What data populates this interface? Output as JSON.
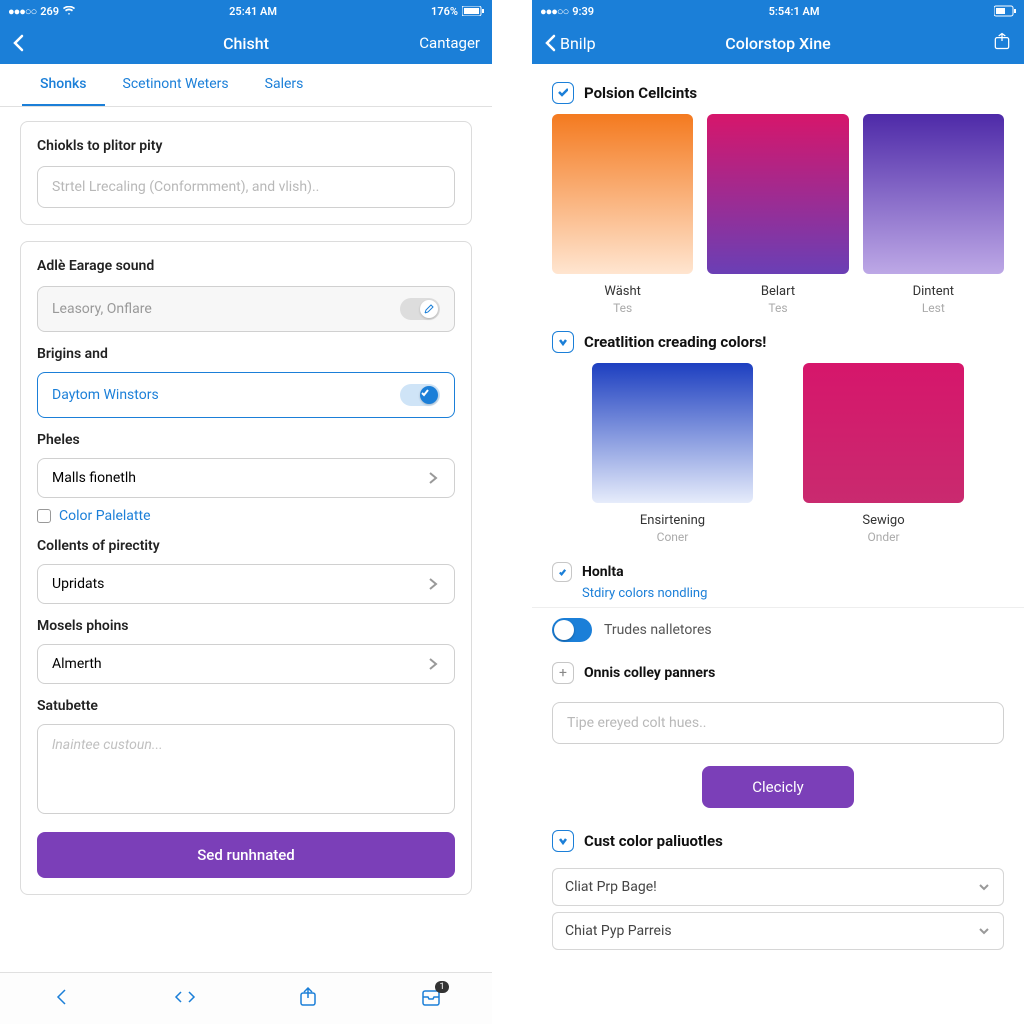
{
  "left": {
    "status": {
      "carrier": "●●●○○",
      "signal": "269",
      "time": "25:41 AM",
      "battery": "176%"
    },
    "nav": {
      "title": "Chisht",
      "right": "Cantager"
    },
    "tabs": [
      "Shonks",
      "Scetinont Weters",
      "Salers"
    ],
    "card1": {
      "title": "Chiokls to plitor pity",
      "placeholder": "Strtel Lrecaling (Conformment), and vlish).."
    },
    "card2": {
      "group_label": "Adlè Earage sound",
      "row1": "Leasory, Onflare",
      "sublabel1": "Brigins and",
      "row2": "Daytom Winstors",
      "sublabel2": "Pheles",
      "row3": "Malls fionetlh",
      "cb_label": "Color Palelatte",
      "sublabel3": "Collents of pirectity",
      "row4": "Upridats",
      "sublabel4": "Mosels phoins",
      "row5": "Almerth",
      "sublabel5": "Satubette",
      "textarea_placeholder": "lnaintee custoun...",
      "submit": "Sed runhnated"
    },
    "tabbar_badge": "1"
  },
  "right": {
    "status": {
      "carrier": "●●●○○",
      "signal": "9:39",
      "time": "5:54:1 AM"
    },
    "nav": {
      "back": "Bnilp",
      "title": "Colorstop Xine"
    },
    "sec1": {
      "title": "Polsion Cellcints",
      "swatches": [
        {
          "name": "Wäsht",
          "sub": "Tes",
          "from": "#f47a1f",
          "to": "#ffe5d0"
        },
        {
          "name": "Belart",
          "sub": "Tes",
          "from": "#d6166b",
          "to": "#6a3fb5"
        },
        {
          "name": "Dintent",
          "sub": "Lest",
          "from": "#4e2aa8",
          "to": "#bda8e6"
        }
      ]
    },
    "sec2": {
      "title": "Creatlition creading colors!",
      "swatches": [
        {
          "name": "Ensirtening",
          "sub": "Coner",
          "from": "#1d3fc0",
          "to": "#e6ecfb"
        },
        {
          "name": "Sewigo",
          "sub": "Onder",
          "from": "#d6166b",
          "to": "#c92a6f"
        }
      ]
    },
    "honta": {
      "title": "Honlta",
      "sub": "Stdiry colors nondling"
    },
    "toggle_label": "Trudes nalletores",
    "panners": {
      "title": "Onnis colley panners",
      "placeholder": "Tipe ereyed colt hues.."
    },
    "btn": "Clecicly",
    "sec3": {
      "title": "Cust color paliuotles"
    },
    "dd1": "Cliat Prp Bage!",
    "dd2": "Chiat Pyp Parreis"
  }
}
